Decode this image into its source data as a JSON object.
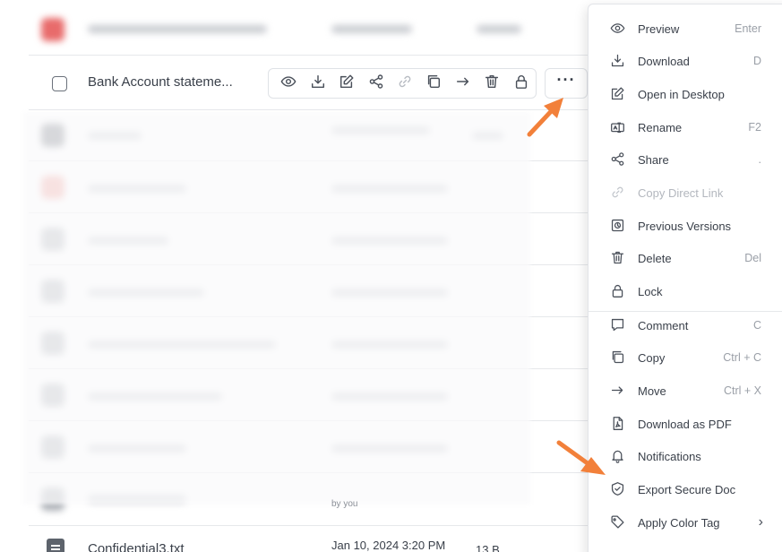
{
  "selected_row": {
    "file_name": "Bank Account stateme...",
    "actions": [
      {
        "name": "preview-action",
        "icon": "eye-icon"
      },
      {
        "name": "download-action",
        "icon": "download-icon"
      },
      {
        "name": "edit-action",
        "icon": "edit-icon"
      },
      {
        "name": "share-action",
        "icon": "share-icon"
      },
      {
        "name": "link-action",
        "icon": "link-icon",
        "disabled": true
      },
      {
        "name": "copy-action",
        "icon": "copy-icon"
      },
      {
        "name": "move-action",
        "icon": "arrow-right-icon"
      },
      {
        "name": "delete-action",
        "icon": "trash-icon"
      },
      {
        "name": "lock-action",
        "icon": "lock-icon"
      }
    ],
    "more_label": "···"
  },
  "last_row": {
    "file_name": "Confidential3.txt",
    "date": "Jan 10, 2024 3:20 PM",
    "size": "13 B",
    "owner_hint": "by you"
  },
  "menu": {
    "items": [
      {
        "label": "Preview",
        "shortcut": "Enter",
        "icon": "eye-icon"
      },
      {
        "label": "Download",
        "shortcut": "D",
        "icon": "download-icon"
      },
      {
        "label": "Open in Desktop",
        "shortcut": "",
        "icon": "edit-icon"
      },
      {
        "label": "Rename",
        "shortcut": "F2",
        "icon": "rename-icon"
      },
      {
        "label": "Share",
        "shortcut": ".",
        "icon": "share-icon"
      },
      {
        "label": "Copy Direct Link",
        "shortcut": "",
        "icon": "link-icon",
        "disabled": true
      },
      {
        "label": "Previous Versions",
        "shortcut": "",
        "icon": "versions-icon"
      },
      {
        "label": "Delete",
        "shortcut": "Del",
        "icon": "trash-icon"
      },
      {
        "label": "Lock",
        "shortcut": "",
        "icon": "lock-icon"
      },
      {
        "label": "Comment",
        "shortcut": "C",
        "icon": "comment-icon"
      },
      {
        "label": "Copy",
        "shortcut": "Ctrl + C",
        "icon": "copy-icon"
      },
      {
        "label": "Move",
        "shortcut": "Ctrl + X",
        "icon": "arrow-right-icon"
      },
      {
        "label": "Download as PDF",
        "shortcut": "",
        "icon": "pdf-icon"
      },
      {
        "label": "Notifications",
        "shortcut": "",
        "icon": "bell-icon"
      },
      {
        "label": "Export Secure Doc",
        "shortcut": "",
        "icon": "shield-check-icon"
      },
      {
        "label": "Apply Color Tag",
        "shortcut": "",
        "icon": "tag-icon",
        "submenu": true
      }
    ]
  },
  "colors": {
    "annotation_arrow": "#f2803a",
    "accent_blur_red": "#e45a5a"
  }
}
